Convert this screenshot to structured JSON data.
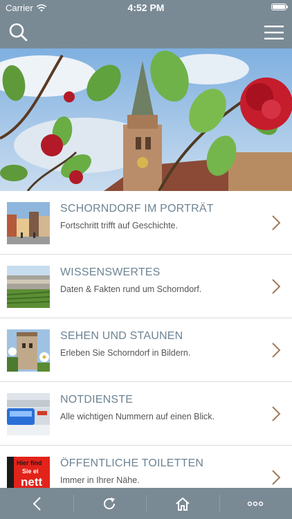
{
  "status_bar": {
    "carrier": "Carrier",
    "time": "4:52 PM"
  },
  "header": {
    "search_icon": "search-icon",
    "menu_icon": "hamburger-menu-icon"
  },
  "list": [
    {
      "title": "SCHORNDORF IM PORTRÄT",
      "subtitle": "Fortschritt trifft auf Geschichte.",
      "thumb": "town-square"
    },
    {
      "title": "WISSENSWERTES",
      "subtitle": "Daten & Fakten rund um Schorndorf.",
      "thumb": "vineyard-town"
    },
    {
      "title": "SEHEN UND STAUNEN",
      "subtitle": "Erleben Sie Schorndorf in Bildern.",
      "thumb": "castle-flowers"
    },
    {
      "title": "NOTDIENSTE",
      "subtitle": "Alle wichtigen Nummern auf einen Blick.",
      "thumb": "police-light"
    },
    {
      "title": "ÖFFENTLICHE TOILETTEN",
      "subtitle": "Immer in Ihrer Nähe.",
      "thumb": "toilet-sign",
      "thumb_text_1": "Hier find",
      "thumb_text_2": "Sie ei",
      "thumb_text_3": "nett"
    }
  ],
  "toolbar": {
    "items": [
      "back-icon",
      "reload-icon",
      "home-icon",
      "more-icon"
    ]
  },
  "colors": {
    "bar": "#7a8a95",
    "title": "#6d8494",
    "chevron": "#a07a5a"
  }
}
